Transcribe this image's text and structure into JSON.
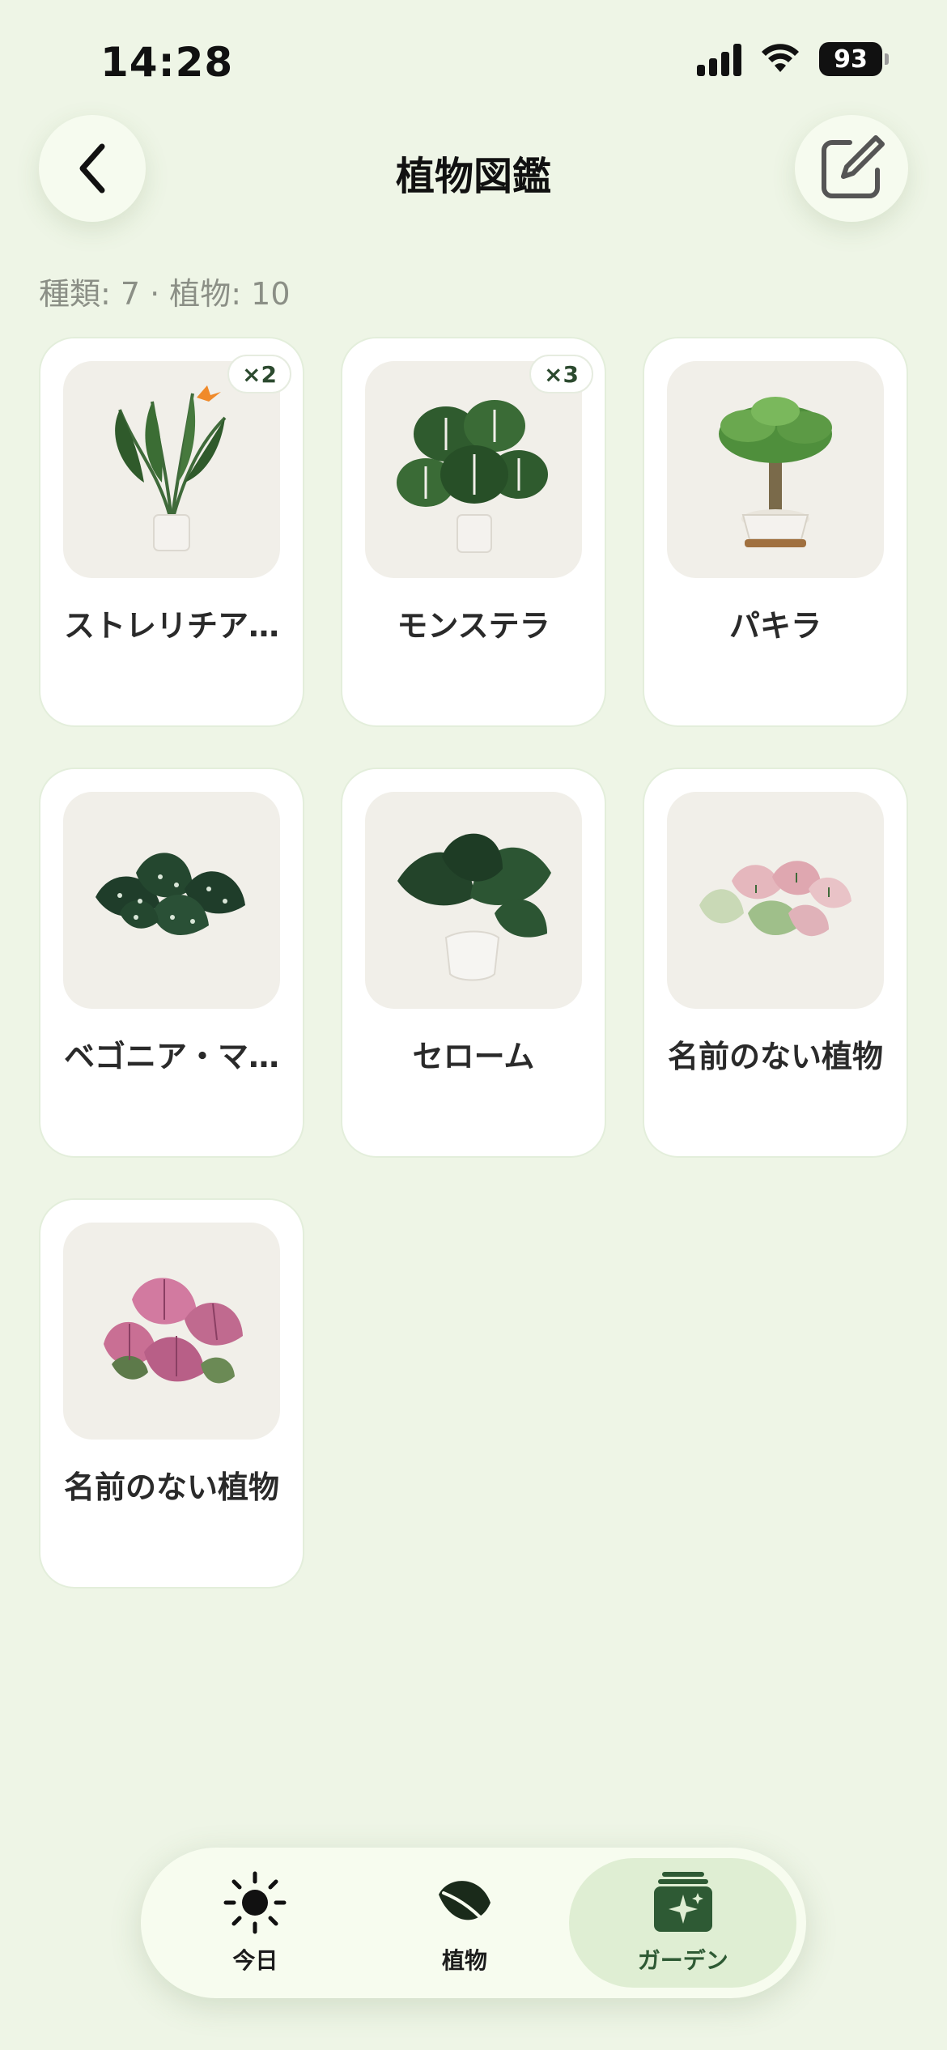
{
  "status": {
    "time": "14:28",
    "battery": "93"
  },
  "header": {
    "title": "植物図鑑"
  },
  "summary": "種類: 7 · 植物: 10",
  "plants": [
    {
      "name": "ストレリチア…",
      "count": "×2",
      "icon": "strelitzia"
    },
    {
      "name": "モンステラ",
      "count": "×3",
      "icon": "monstera"
    },
    {
      "name": "パキラ",
      "count": "",
      "icon": "pachira"
    },
    {
      "name": "ベゴニア・マ…",
      "count": "",
      "icon": "begonia"
    },
    {
      "name": "セローム",
      "count": "",
      "icon": "selloum"
    },
    {
      "name": "名前のない植物",
      "count": "",
      "icon": "caladium-light"
    },
    {
      "name": "名前のない植物",
      "count": "",
      "icon": "caladium-pink"
    }
  ],
  "tabs": [
    {
      "label": "今日",
      "icon": "sun-icon"
    },
    {
      "label": "植物",
      "icon": "leaf-icon"
    },
    {
      "label": "ガーデン",
      "icon": "garden-icon"
    }
  ],
  "active_tab": "ガーデン"
}
